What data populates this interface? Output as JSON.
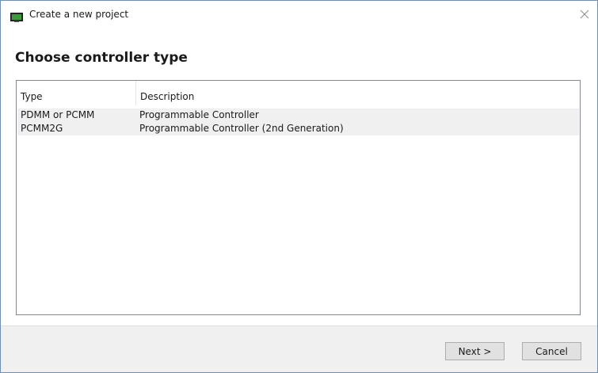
{
  "window": {
    "title": "Create a new project",
    "icon": "app-window-icon",
    "close_icon": "close-icon"
  },
  "page": {
    "title": "Choose controller type"
  },
  "list": {
    "columns": [
      "Type",
      "Description"
    ],
    "rows": [
      {
        "type": "PDMM or PCMM",
        "description": "Programmable Controller"
      },
      {
        "type": "PCMM2G",
        "description": "Programmable Controller (2nd Generation)"
      }
    ]
  },
  "buttons": {
    "next_label": "Next >",
    "cancel_label": "Cancel"
  },
  "colors": {
    "row_background": "#f0f0f0",
    "footer_background": "#f0f0f0",
    "button_face": "#e1e1e1",
    "app_icon_green": "#3c9a3c"
  }
}
